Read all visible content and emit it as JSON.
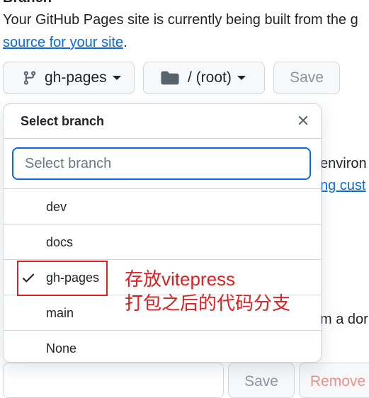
{
  "section": {
    "heading": "Branch",
    "description_prefix": "Your GitHub Pages site is currently being built from the g",
    "description_link": "source for your site",
    "description_suffix": "."
  },
  "controls": {
    "branch_button_label": "gh-pages",
    "folder_button_label": "/ (root)",
    "save_label": "Save"
  },
  "background": {
    "partial_text_1": "environ",
    "partial_link": "ng cust",
    "partial_text_2": "m a dor",
    "bottom_save_label": "Save",
    "bottom_remove_label": "Remove"
  },
  "dropdown": {
    "title": "Select branch",
    "filter_placeholder": "Select branch",
    "items": [
      {
        "label": "dev",
        "selected": false
      },
      {
        "label": "docs",
        "selected": false
      },
      {
        "label": "gh-pages",
        "selected": true
      },
      {
        "label": "main",
        "selected": false
      },
      {
        "label": "None",
        "selected": false
      }
    ]
  },
  "annotation": {
    "line1": "存放vitepress",
    "line2": "打包之后的代码分支",
    "color": "#e02020"
  },
  "icons": {
    "branch": "git-branch-icon",
    "folder": "folder-icon",
    "close": "close-icon",
    "check": "check-icon"
  },
  "colors": {
    "link": "#0969da",
    "focus_border": "#0969da",
    "annotation": "#e02020"
  }
}
